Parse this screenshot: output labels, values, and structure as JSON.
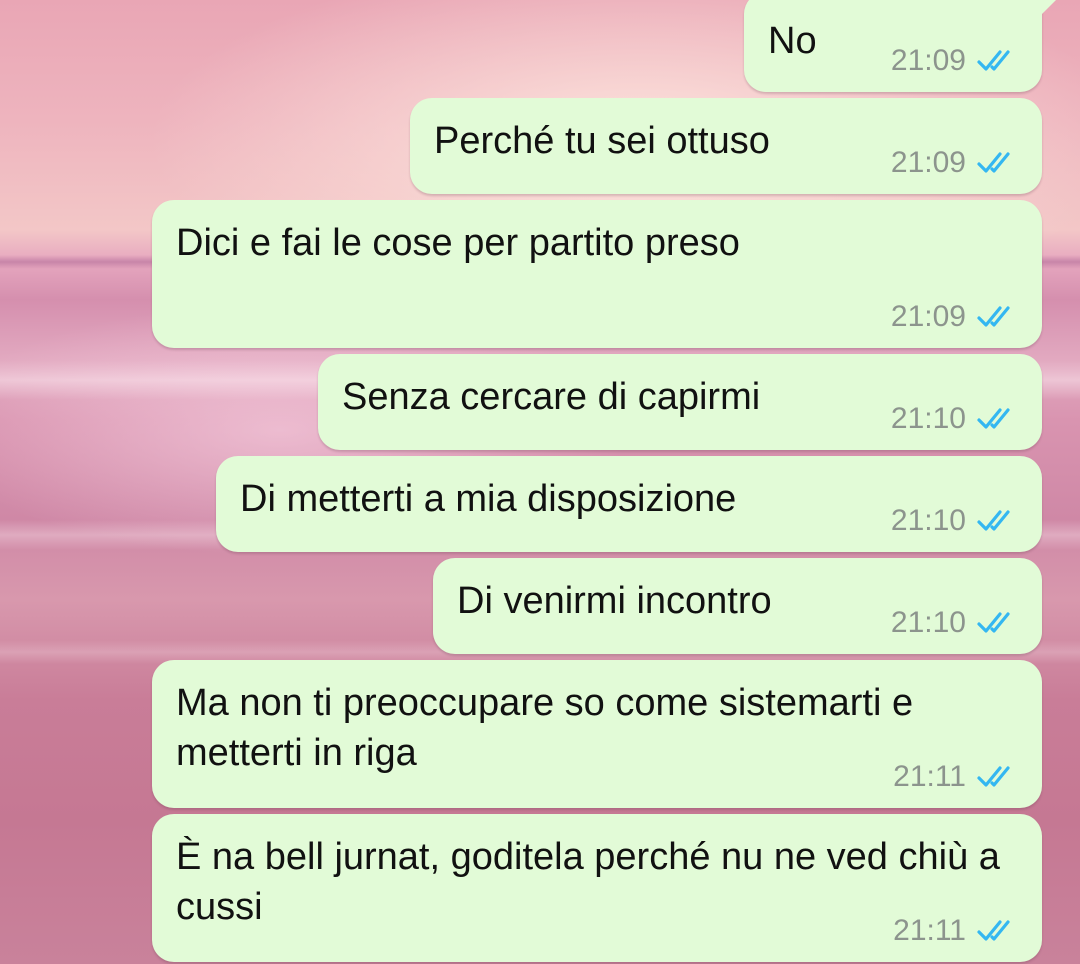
{
  "colors": {
    "bubble": "#e2fbd7",
    "text": "#111111",
    "time": "#8c948d",
    "read_ticks": "#34b7f1"
  },
  "messages": [
    {
      "text": "No",
      "time": "21:09",
      "status_icon": "double-check-read-icon"
    },
    {
      "text": "Perché tu sei ottuso",
      "time": "21:09",
      "status_icon": "double-check-read-icon"
    },
    {
      "text": "Dici e fai le cose per partito preso",
      "time": "21:09",
      "status_icon": "double-check-read-icon"
    },
    {
      "text": "Senza cercare di capirmi",
      "time": "21:10",
      "status_icon": "double-check-read-icon"
    },
    {
      "text": "Di metterti a mia disposizione",
      "time": "21:10",
      "status_icon": "double-check-read-icon"
    },
    {
      "text": "Di venirmi incontro",
      "time": "21:10",
      "status_icon": "double-check-read-icon"
    },
    {
      "text": "Ma non ti preoccupare so come sistemarti e metterti in riga",
      "time": "21:11",
      "status_icon": "double-check-read-icon"
    },
    {
      "text": "È na bell jurnat, goditela perché nu ne ved chiù a cussi",
      "time": "21:11",
      "status_icon": "double-check-read-icon"
    }
  ]
}
